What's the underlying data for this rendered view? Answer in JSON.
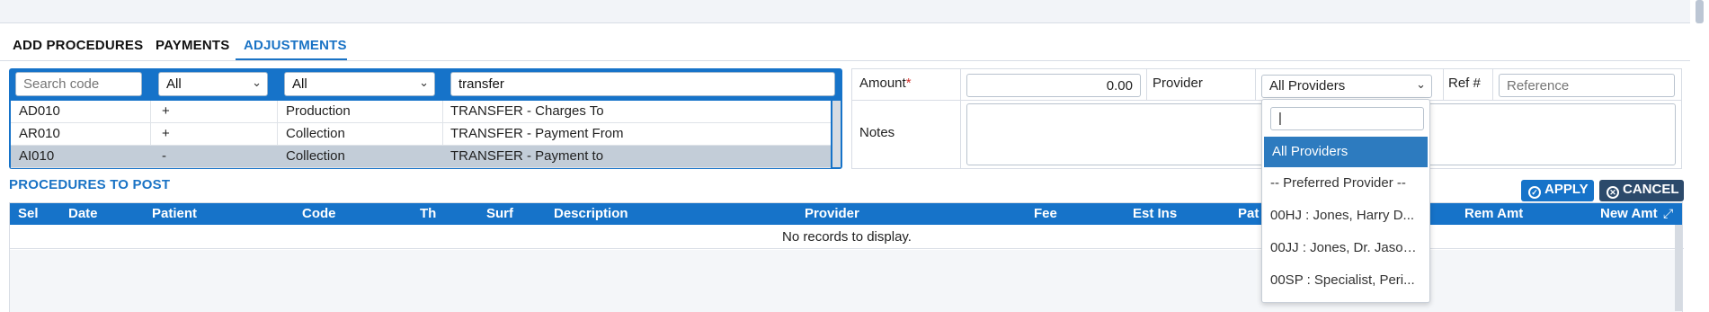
{
  "tabs": [
    {
      "label": "ADD PROCEDURES"
    },
    {
      "label": "PAYMENTS"
    },
    {
      "label": "ADJUSTMENTS"
    }
  ],
  "code_search": {
    "placeholder": "Search code",
    "filter1_value": "All",
    "filter2_value": "All",
    "text_value": "transfer"
  },
  "codes": [
    {
      "code": "AD010",
      "sign": "+",
      "category": "Production",
      "description": "TRANSFER - Charges To"
    },
    {
      "code": "AR010",
      "sign": "+",
      "category": "Collection",
      "description": "TRANSFER - Payment From"
    },
    {
      "code": "AI010",
      "sign": "-",
      "category": "Collection",
      "description": "TRANSFER - Payment to"
    }
  ],
  "form": {
    "amount_label": "Amount",
    "required_mark": "*",
    "amount_value": "0.00",
    "provider_label": "Provider",
    "provider_value": "All Providers",
    "ref_label": "Ref #",
    "ref_placeholder": "Reference",
    "notes_label": "Notes"
  },
  "provider_dropdown": {
    "search_value": "|",
    "options": [
      "All Providers",
      "-- Preferred Provider --",
      "00HJ : Jones, Harry D...",
      "00JJ : Jones, Dr. Jason...",
      "00SP : Specialist, Peri..."
    ]
  },
  "procedures": {
    "title": "PROCEDURES TO POST",
    "apply_label": "APPLY",
    "cancel_label": "CANCEL",
    "columns": [
      "Sel",
      "Date",
      "Patient",
      "Code",
      "Th",
      "Surf",
      "Description",
      "Provider",
      "Fee",
      "Est Ins",
      "Pat",
      "Rem Amt",
      "New Amt"
    ],
    "empty_message": "No records to display."
  },
  "colors": {
    "accent": "#1673c9",
    "selected_row": "#c3cdd8",
    "cancel_button": "#2c4a6b"
  }
}
